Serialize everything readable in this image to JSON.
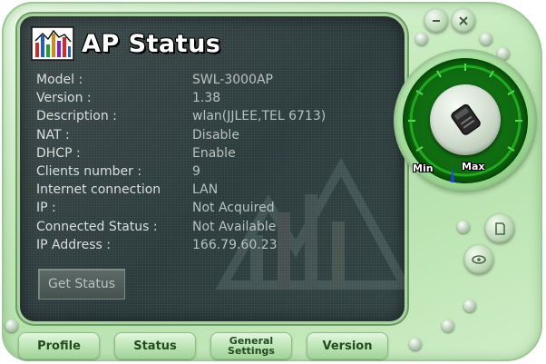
{
  "window": {
    "title": "AP Status"
  },
  "info_rows": [
    {
      "key": "Model :",
      "value": "SWL-3000AP"
    },
    {
      "key": "Version :",
      "value": "1.38"
    },
    {
      "key": "Description :",
      "value": "wlan(JJLEE,TEL 6713)"
    },
    {
      "key": "NAT :",
      "value": "Disable"
    },
    {
      "key": "DHCP :",
      "value": "Enable"
    },
    {
      "key": "Clients number :",
      "value": "9"
    },
    {
      "key": "Internet connection",
      "value": "LAN"
    },
    {
      "key": "IP :",
      "value": "Not Acquired"
    },
    {
      "key": "Connected Status :",
      "value": "Not Available"
    },
    {
      "key": "IP Address :",
      "value": "166.79.60.23"
    }
  ],
  "buttons": {
    "get_status": "Get Status"
  },
  "gauge": {
    "min_label": "Min",
    "max_label": "Max",
    "accent": "#1fb51a"
  },
  "tabs": {
    "profile": "Profile",
    "status": "Status",
    "general_line1": "General",
    "general_line2": "Settings",
    "version": "Version"
  },
  "icons": {
    "minimize": "minimize-icon",
    "close": "close-icon",
    "knob": "wireless-device-icon",
    "logo": "bar-chart-logo-icon"
  }
}
